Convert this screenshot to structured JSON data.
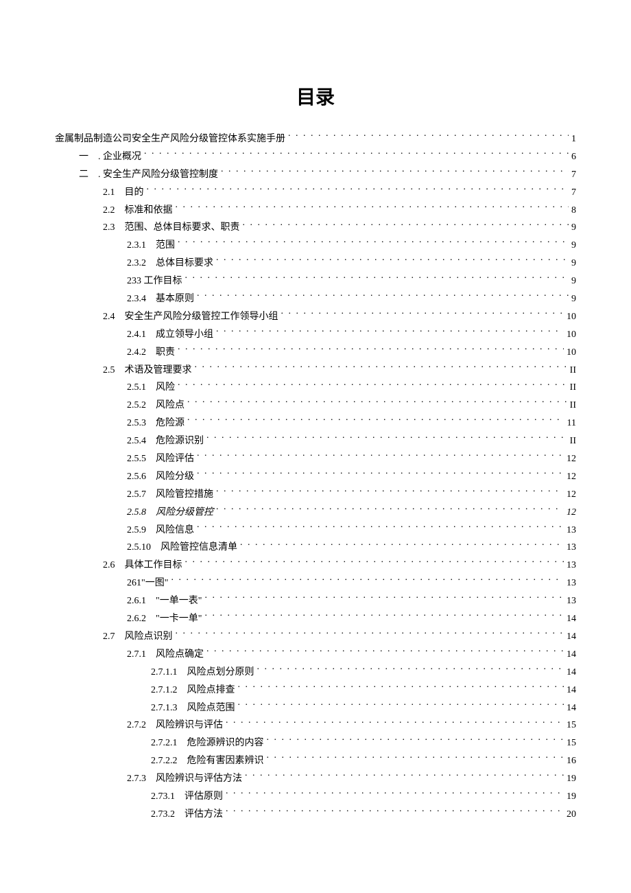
{
  "title": "目录",
  "entries": [
    {
      "indent": 0,
      "num": "",
      "text": "金属制品制造公司安全生产风险分级管控体系实施手册",
      "page": "1",
      "italic": false
    },
    {
      "indent": 1,
      "num": "一",
      "text": ". 企业概况",
      "page": "6",
      "italic": false
    },
    {
      "indent": 1,
      "num": "二",
      "text": ". 安全生产风险分级管控制度",
      "page": "7",
      "italic": false
    },
    {
      "indent": 2,
      "num": "2.1",
      "text": "目的",
      "page": "7",
      "italic": false
    },
    {
      "indent": 2,
      "num": "2.2",
      "text": "标准和依据",
      "page": "8",
      "italic": false
    },
    {
      "indent": 2,
      "num": "2.3",
      "text": "范围、总体目标要求、职责",
      "page": "9",
      "italic": false
    },
    {
      "indent": 3,
      "num": "2.3.1",
      "text": "范围",
      "page": "9",
      "italic": false
    },
    {
      "indent": 3,
      "num": "2.3.2",
      "text": "总体目标要求",
      "page": "9",
      "italic": false
    },
    {
      "indent": 3,
      "num": "",
      "text": "233 工作目标",
      "page": "9",
      "italic": false
    },
    {
      "indent": 3,
      "num": "2.3.4",
      "text": "基本原则",
      "page": "9",
      "italic": false
    },
    {
      "indent": 2,
      "num": "2.4",
      "text": "安全生产风险分级管控工作领导小组",
      "page": "10",
      "italic": false
    },
    {
      "indent": 3,
      "num": "2.4.1",
      "text": "成立领导小组",
      "page": "10",
      "italic": false
    },
    {
      "indent": 3,
      "num": "2.4.2",
      "text": "职责",
      "page": "10",
      "italic": false
    },
    {
      "indent": 2,
      "num": "2.5",
      "text": "术语及管理要求",
      "page": "II",
      "italic": false
    },
    {
      "indent": 3,
      "num": "2.5.1",
      "text": "风险",
      "page": "II",
      "italic": false
    },
    {
      "indent": 3,
      "num": "2.5.2",
      "text": "风险点",
      "page": "II",
      "italic": false
    },
    {
      "indent": 3,
      "num": "2.5.3",
      "text": "危险源",
      "page": "11",
      "italic": false
    },
    {
      "indent": 3,
      "num": "2.5.4",
      "text": "危险源识别",
      "page": "II",
      "italic": false
    },
    {
      "indent": 3,
      "num": "2.5.5",
      "text": "风险评估",
      "page": "12",
      "italic": false
    },
    {
      "indent": 3,
      "num": "2.5.6",
      "text": "风险分级",
      "page": "12",
      "italic": false
    },
    {
      "indent": 3,
      "num": "2.5.7",
      "text": "风险管控措施",
      "page": "12",
      "italic": false
    },
    {
      "indent": 3,
      "num": "2.5.8",
      "text": "风险分级管控",
      "page": "12",
      "italic": true
    },
    {
      "indent": 3,
      "num": "2.5.9",
      "text": "风险信息",
      "page": "13",
      "italic": false
    },
    {
      "indent": 3,
      "num": "2.5.10",
      "text": "风险管控信息清单",
      "page": "13",
      "italic": false
    },
    {
      "indent": 2,
      "num": "2.6",
      "text": "具体工作目标",
      "page": "13",
      "italic": false
    },
    {
      "indent": 3,
      "num": "",
      "text": "261\"一图\"",
      "page": "13",
      "italic": false
    },
    {
      "indent": 3,
      "num": "2.6.1",
      "text": "\"一单一表\"",
      "page": "13",
      "italic": false
    },
    {
      "indent": 3,
      "num": "2.6.2",
      "text": "\"一卡一单\"",
      "page": "14",
      "italic": false
    },
    {
      "indent": 2,
      "num": "2.7",
      "text": "风险点识别",
      "page": "14",
      "italic": false
    },
    {
      "indent": 3,
      "num": "2.7.1",
      "text": "风险点确定",
      "page": "14",
      "italic": false
    },
    {
      "indent": 4,
      "num": "2.7.1.1",
      "text": "风险点划分原则",
      "page": "14",
      "italic": false
    },
    {
      "indent": 4,
      "num": "2.7.1.2",
      "text": "风险点排查",
      "page": "14",
      "italic": false
    },
    {
      "indent": 4,
      "num": "2.7.1.3",
      "text": "风险点范围",
      "page": "14",
      "italic": false
    },
    {
      "indent": 3,
      "num": "2.7.2",
      "text": "风险辨识与评估",
      "page": "15",
      "italic": false
    },
    {
      "indent": 4,
      "num": "2.7.2.1",
      "text": "危险源辨识的内容",
      "page": "15",
      "italic": false
    },
    {
      "indent": 4,
      "num": "2.7.2.2",
      "text": "危险有害因素辨识",
      "page": "16",
      "italic": false
    },
    {
      "indent": 3,
      "num": "2.7.3",
      "text": "风险辨识与评估方法",
      "page": "19",
      "italic": false
    },
    {
      "indent": 4,
      "num": "2.73.1",
      "text": "评估原则",
      "page": "19",
      "italic": false
    },
    {
      "indent": 4,
      "num": "2.73.2",
      "text": "评估方法",
      "page": "20",
      "italic": false
    }
  ]
}
